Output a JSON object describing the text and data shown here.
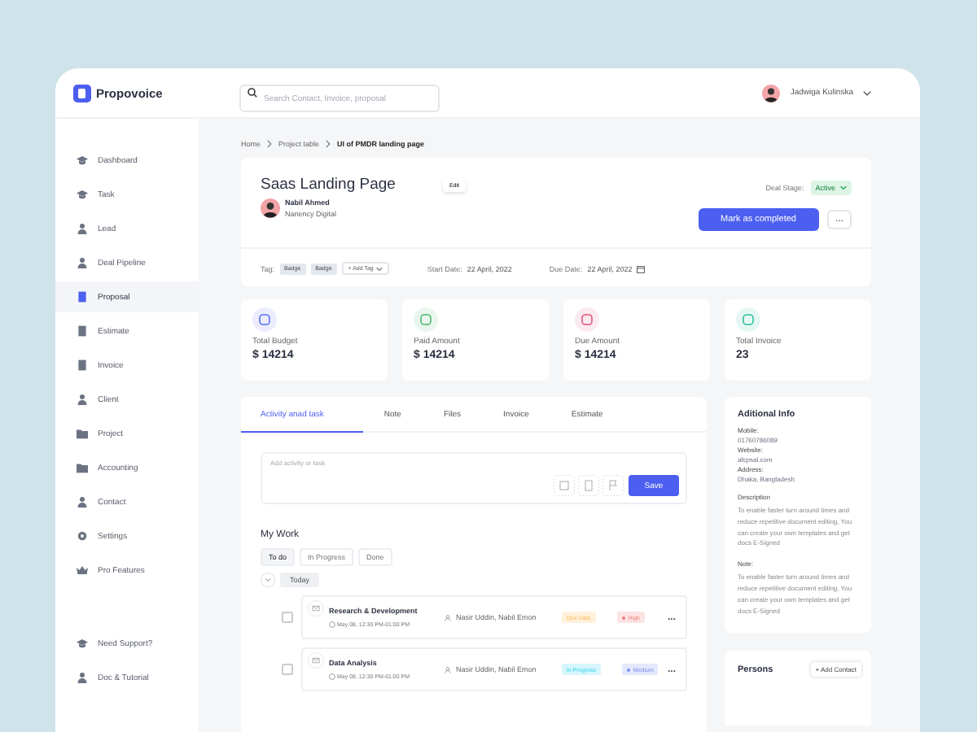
{
  "brand": "Propovoice",
  "search": {
    "placeholder": "Search Contact, Invoice, proposal"
  },
  "user": {
    "name": "Jadwiga Kulinska"
  },
  "sidebar": {
    "items": [
      {
        "label": "Dashboard",
        "selected": false
      },
      {
        "label": "Task",
        "selected": false
      },
      {
        "label": "Lead",
        "selected": false
      },
      {
        "label": "Deal Pipeline",
        "selected": false
      },
      {
        "label": "Proposal",
        "selected": true
      },
      {
        "label": "Estimate",
        "selected": false
      },
      {
        "label": "Invoice",
        "selected": false
      },
      {
        "label": "Client",
        "selected": false
      },
      {
        "label": "Project",
        "selected": false
      },
      {
        "label": "Accounting",
        "selected": false
      },
      {
        "label": "Contact",
        "selected": false
      },
      {
        "label": "Settings",
        "selected": false
      },
      {
        "label": "Pro Features",
        "selected": false
      }
    ],
    "footer_items": [
      "Need Support?",
      "Doc & Tutorial"
    ]
  },
  "breadcrumb": [
    "Home",
    "Project table",
    "UI of PMDR landing page"
  ],
  "project": {
    "title": "Saas Landing Page",
    "edit_button": "Edit",
    "owner_name": "Nabil Ahmed",
    "owner_company": "Nanency Digital",
    "deal_stage_label": "Deal Stage:",
    "deal_stage": "Active",
    "complete_button": "Mark as completed",
    "more_button": "...",
    "tag_label": "Tag:",
    "tags": [
      "Badge",
      "Badge"
    ],
    "add_tag": "+ Add Tag",
    "start_label": "Start Date:",
    "start_date": "22 April, 2022",
    "due_label": "Due Date:",
    "due_date": "22 April, 2022"
  },
  "stats": [
    {
      "label": "Total Budget",
      "value": "$ 14214",
      "color": "#5b6cf5"
    },
    {
      "label": "Paid Amount",
      "value": "$ 14214",
      "color": "#4cb96b"
    },
    {
      "label": "Due Amount",
      "value": "$ 14214",
      "color": "#e0557c"
    },
    {
      "label": "Total Invoice",
      "value": "23",
      "color": "#2fbf9f"
    }
  ],
  "tabs": [
    {
      "label": "Activity anad task",
      "selected": true
    },
    {
      "label": "Note",
      "selected": false
    },
    {
      "label": "Files",
      "selected": false
    },
    {
      "label": "Invoice",
      "selected": false
    },
    {
      "label": "Estimate",
      "selected": false
    }
  ],
  "activity_input": {
    "placeholder": "Add activity or task"
  },
  "save_button": "Save",
  "my_work": {
    "title": "My Work",
    "filters": [
      {
        "label": "To do",
        "selected": true
      },
      {
        "label": "In Progress",
        "selected": false
      },
      {
        "label": "Done",
        "selected": false
      }
    ],
    "group": {
      "label": "Today",
      "expanded": true
    },
    "tasks": [
      {
        "title": "Research & Development",
        "time": "May 08, 12:30 PM-01:00 PM",
        "assignees": "Nasir Uddin, Nabil Emon",
        "checked": false,
        "status": {
          "label": "Due Date",
          "color": "#fff1dc"
        },
        "priority": {
          "label": "High",
          "color": "#fde4e4"
        },
        "more": "..."
      },
      {
        "title": "Data Analysis",
        "time": "May 08, 12:30 PM-01:00 PM",
        "assignees": "Nasir Uddin, Nabil Emon",
        "checked": false,
        "status": {
          "label": "In Progress",
          "color": "#d6f6fb"
        },
        "priority": {
          "label": "Medium",
          "color": "#e4e8fc"
        },
        "more": "..."
      }
    ]
  },
  "info": {
    "title": "Aditional Info",
    "fields": [
      {
        "label": "Mobile:",
        "value": "01760786089"
      },
      {
        "label": "Website:",
        "value": "afcpsal.com"
      },
      {
        "label": "Address:",
        "value": "Dhaka, Bangladesh"
      }
    ],
    "description_label": "Description",
    "description": "To enable faster turn around times and reduce repetitive document editing, You can create your own templates and get docs E-Signed",
    "note_label": "Note:",
    "note": "To enable faster turn around times and reduce repetitive document editing, You can create your own templates and get docs E-Signed"
  },
  "persons": {
    "title": "Persons",
    "add_button": "+ Add Contact"
  }
}
